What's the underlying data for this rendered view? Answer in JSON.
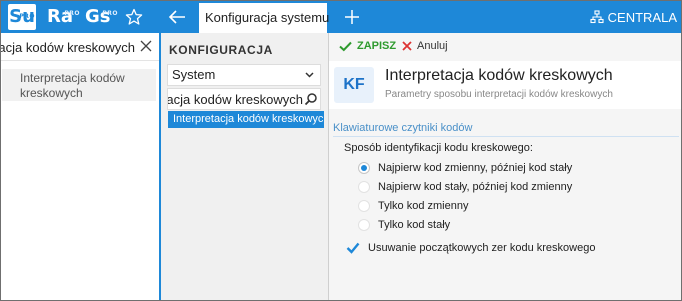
{
  "topbar": {
    "apps": [
      {
        "label": "Su",
        "badge": "PRO"
      },
      {
        "label": "Ra",
        "badge": "PRO"
      },
      {
        "label": "Gs",
        "badge": "PRO"
      }
    ],
    "active_tab": "Konfiguracja systemu",
    "org_label": "CENTRALA",
    "accent": "#1e88d8"
  },
  "left_panel": {
    "search_value": "Interpretacja kodów kreskowych",
    "items": [
      "Interpretacja kodów kreskowych"
    ]
  },
  "middle_panel": {
    "title": "KONFIGURACJA",
    "select_value": "System",
    "search_value": "Interpretacja kodów kreskowych",
    "items": [
      "Interpretacja kodów kreskowych"
    ]
  },
  "toolbar": {
    "save_label": "ZAPISZ",
    "cancel_label": "Anuluj"
  },
  "header": {
    "badge": "KF",
    "title": "Interpretacja kodów kreskowych",
    "subtitle": "Parametry sposobu interpretacji kodów kreskowych"
  },
  "form": {
    "section_title": "Klawiaturowe czytniki kodów",
    "question": "Sposób identyfikacji kodu kreskowego:",
    "options": [
      {
        "label": "Najpierw kod zmienny, później kod stały",
        "selected": true
      },
      {
        "label": "Najpierw kod stały, później kod zmienny",
        "selected": false
      },
      {
        "label": "Tylko kod zmienny",
        "selected": false
      },
      {
        "label": "Tylko kod stały",
        "selected": false
      }
    ],
    "checkbox_label": "Usuwanie początkowych zer kodu kreskowego",
    "checkbox_checked": true
  }
}
